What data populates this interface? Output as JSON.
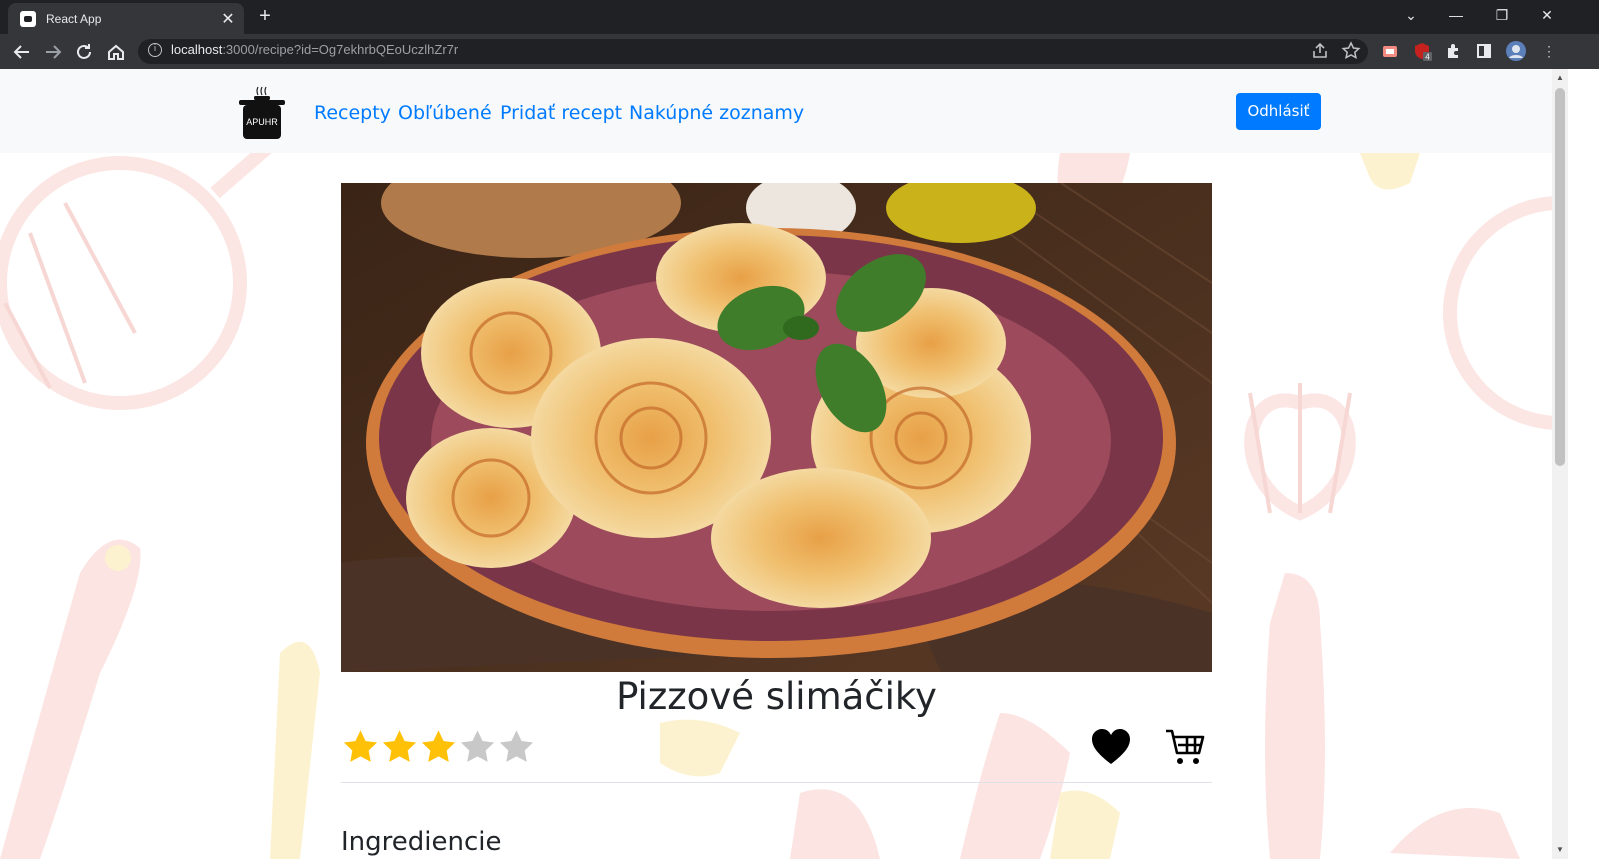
{
  "browser": {
    "tab_title": "React App",
    "tab_close": "✕",
    "new_tab": "+",
    "url_host": "localhost",
    "url_rest": ":3000/recipe?id=Og7ekhrbQEoUczlhZr7r",
    "extension_badge": "4"
  },
  "navbar": {
    "logo_text": "APUHR",
    "links": [
      "Recepty",
      "Obľúbené",
      "Pridať recept",
      "Nakúpné zoznamy"
    ],
    "logout_label": "Odhlásiť"
  },
  "recipe": {
    "title": "Pizzové slimáčiky",
    "rating": 3,
    "max_rating": 5,
    "favorite": true,
    "section_heading": "Ingrediencie"
  },
  "colors": {
    "accent": "#007bff",
    "star_filled": "#ffc107",
    "star_empty": "#c8c8c8",
    "navbar_bg": "#f8f9fa"
  },
  "icons": [
    "logo-pot-icon",
    "star-icon",
    "heart-icon",
    "cart-icon",
    "back-icon",
    "forward-icon",
    "reload-icon",
    "home-icon",
    "info-icon",
    "share-icon",
    "bookmark-star-icon",
    "extensions-icon",
    "sidepanel-icon",
    "profile-icon",
    "menu-icon"
  ]
}
